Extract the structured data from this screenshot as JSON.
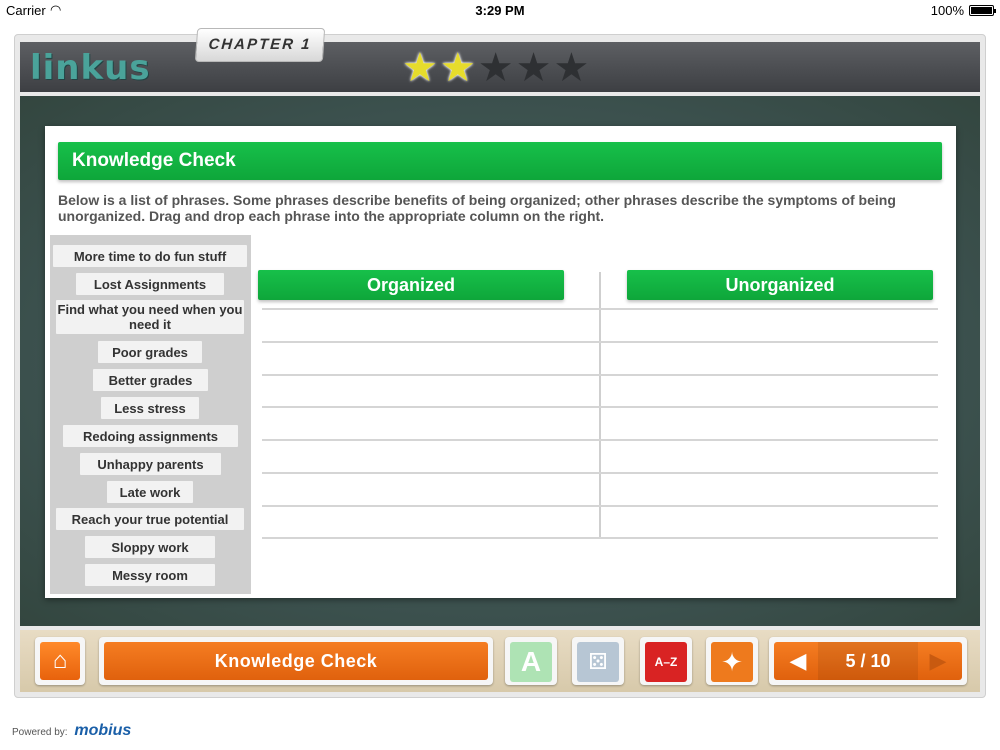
{
  "status_bar": {
    "carrier": "Carrier",
    "time": "3:29 PM",
    "battery": "100%"
  },
  "header": {
    "logo": "linkus",
    "chapter": "CHAPTER 1",
    "stars_filled": 2,
    "stars_total": 5
  },
  "activity": {
    "title": "Knowledge Check",
    "instructions": "Below is a list of phrases. Some phrases describe benefits of being organized; other phrases describe the symptoms of being unorganized. Drag and drop each phrase into the appropriate column on the right.",
    "phrases": [
      "More time to do fun stuff",
      "Lost Assignments",
      "Find what you need when you need it",
      "Poor grades",
      "Better grades",
      "Less stress",
      "Redoing assignments",
      "Unhappy parents",
      "Late work",
      "Reach your true potential",
      "Sloppy work",
      "Messy room"
    ],
    "columns": [
      "Organized",
      "Unorganized"
    ],
    "drop_rows": 7
  },
  "bottom_nav": {
    "section_title": "Knowledge Check",
    "page_indicator": "5 / 10",
    "icons": [
      "home-icon",
      "a-plus-icon",
      "gamepad-icon",
      "a-z-glossary-icon",
      "compass-icon",
      "previous-icon",
      "next-icon"
    ]
  },
  "footer": {
    "powered_by": "Powered by:",
    "brand": "mobius"
  },
  "colors": {
    "green": "#12b341",
    "orange": "#ef7018",
    "board": "#3f5552"
  }
}
